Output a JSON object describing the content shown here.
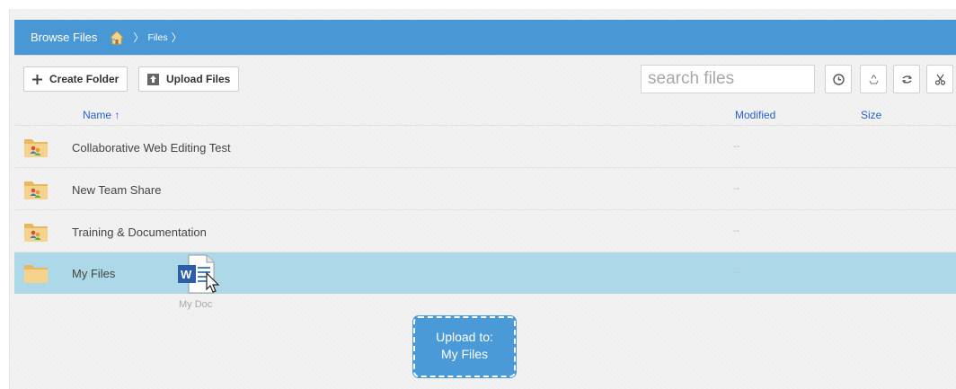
{
  "header": {
    "title": "Browse Files",
    "breadcrumb_sep": "〉",
    "breadcrumb_files": "Files"
  },
  "toolbar": {
    "create_folder": "Create Folder",
    "upload_files": "Upload Files",
    "search_placeholder": "search files"
  },
  "columns": {
    "name": "Name ↑",
    "modified": "Modified",
    "size": "Size"
  },
  "rows": [
    {
      "name": "Collaborative Web Editing Test",
      "modified": "--"
    },
    {
      "name": "New Team Share",
      "modified": "--"
    },
    {
      "name": "Training & Documentation",
      "modified": "--"
    },
    {
      "name": "My Files",
      "modified": "--"
    }
  ],
  "drag": {
    "file_label": "My Doc"
  },
  "upload_target": {
    "line1": "Upload to:",
    "line2": "My Files"
  },
  "colors": {
    "header": "#4a97d6",
    "selected_row": "#acd8e7",
    "link": "#2a61c9"
  }
}
